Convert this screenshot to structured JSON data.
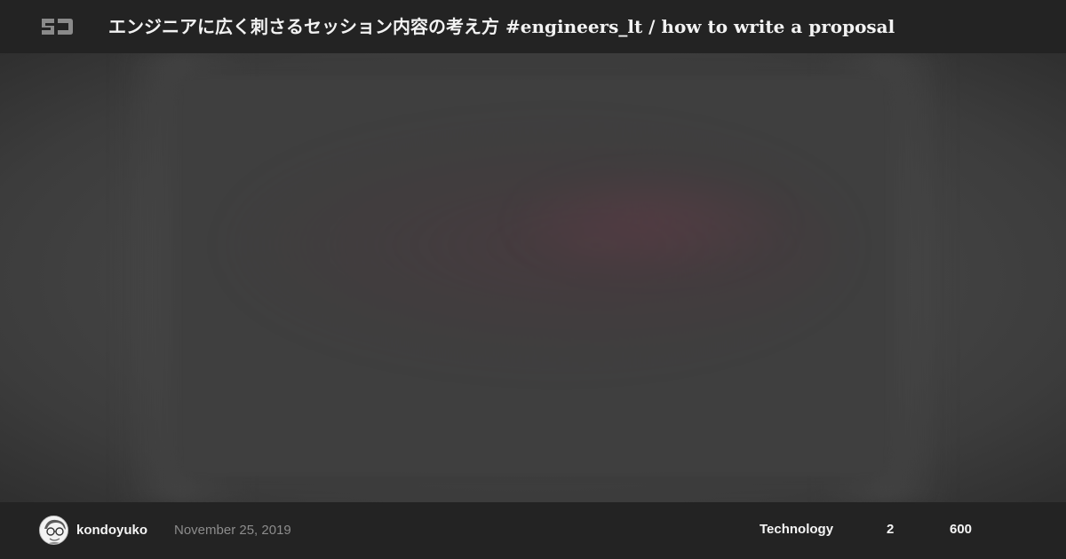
{
  "header": {
    "logo_icon": "speakerdeck-logo-icon",
    "title": "エンジニアに広く刺さるセッション内容の考え方 #engineers_lt / how to write a proposal"
  },
  "slide": {
    "state": "blurred-preview"
  },
  "footer": {
    "avatar_icon": "user-avatar-icon",
    "author": "kondoyuko",
    "date": "November 25, 2019",
    "category": "Technology",
    "stat_a": "2",
    "stat_b": "600"
  },
  "colors": {
    "header_bg": "#232323",
    "footer_bg": "#232323",
    "stage_bg": "#444444",
    "title_text": "#f2f2f2",
    "date_text": "#8c8c8c"
  }
}
